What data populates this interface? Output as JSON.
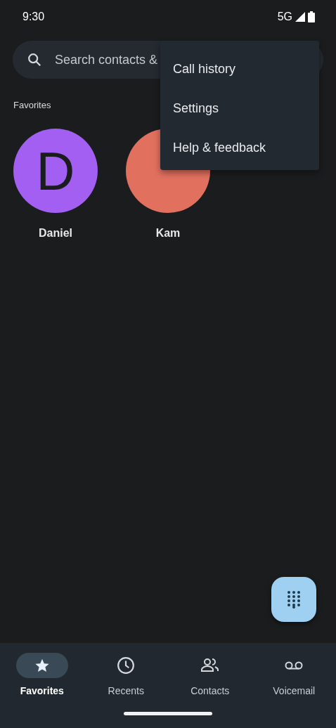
{
  "status_bar": {
    "time": "9:30",
    "network": "5G"
  },
  "search": {
    "placeholder": "Search contacts &"
  },
  "menu": {
    "items": [
      "Call history",
      "Settings",
      "Help & feedback"
    ]
  },
  "favorites": {
    "heading": "Favorites",
    "contacts": [
      {
        "initial": "D",
        "name": "Daniel",
        "color": "#a35ef2"
      },
      {
        "name": "Kam",
        "color": "#e2705f"
      }
    ]
  },
  "nav": [
    {
      "kind": "favorites",
      "label": "Favorites",
      "selected": true
    },
    {
      "kind": "recents",
      "label": "Recents",
      "selected": false
    },
    {
      "kind": "contacts",
      "label": "Contacts",
      "selected": false
    },
    {
      "kind": "voicemail",
      "label": "Voicemail",
      "selected": false
    }
  ]
}
